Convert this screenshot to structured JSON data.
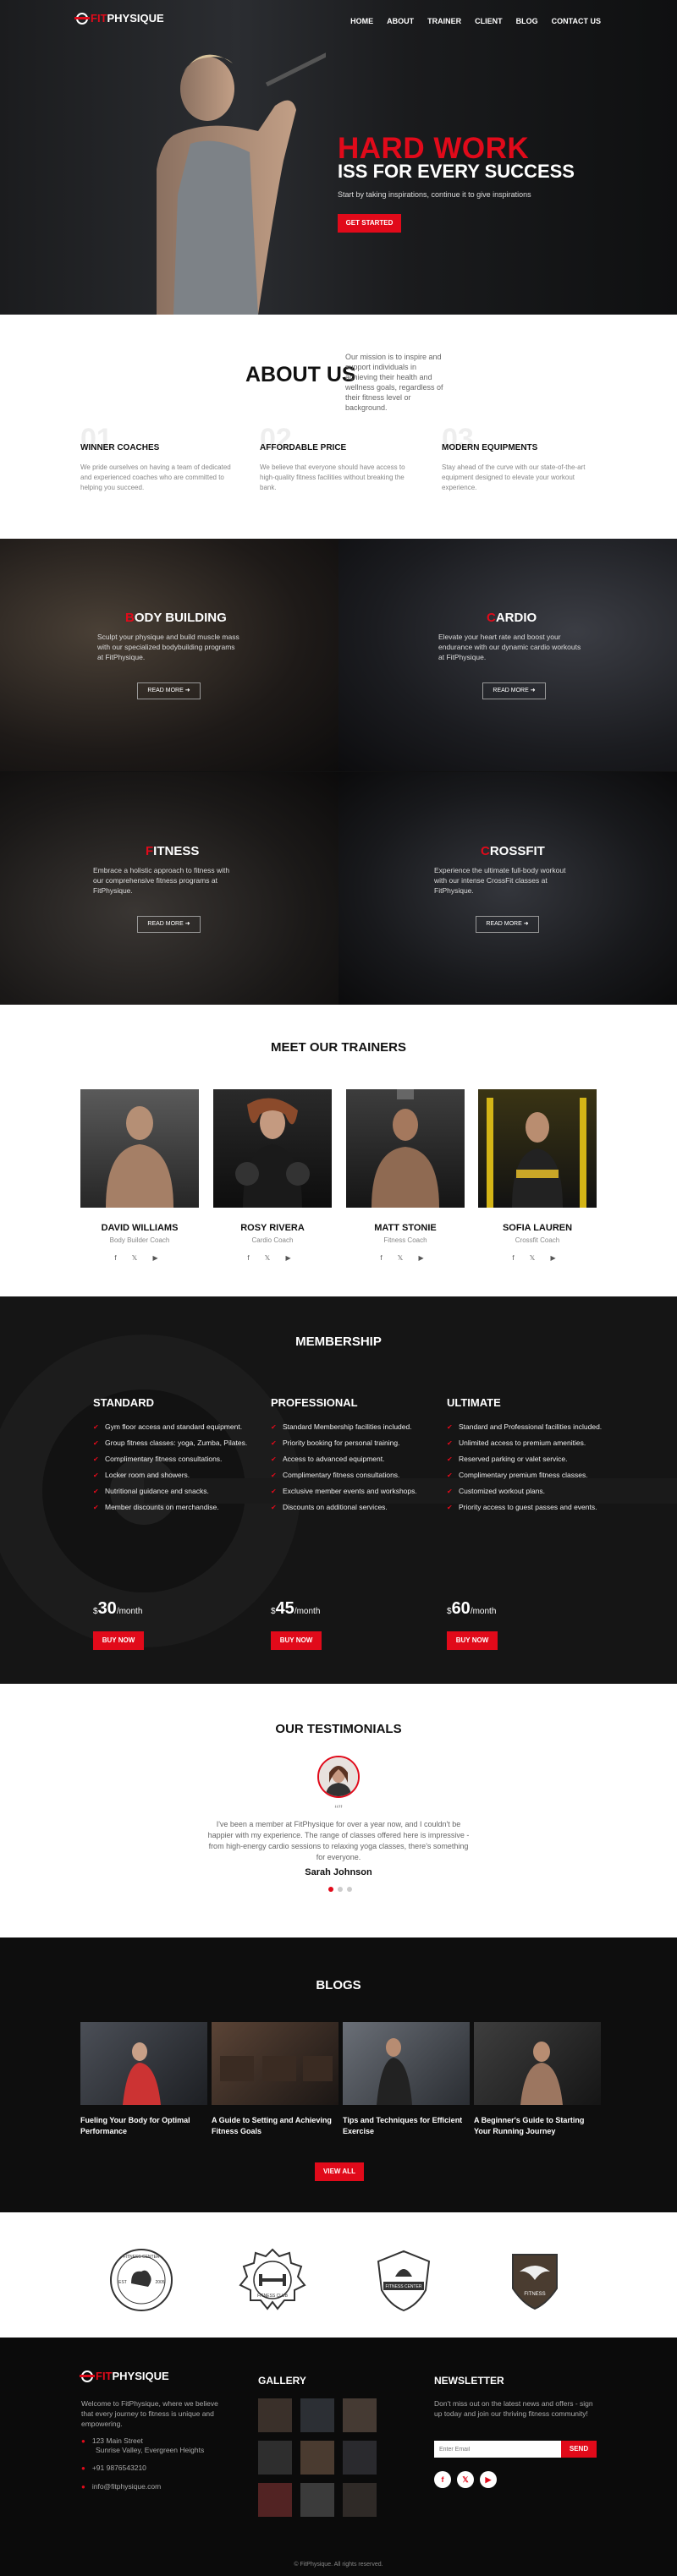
{
  "brand": {
    "prefix": "FIT",
    "name": "PHYSIQUE"
  },
  "nav": {
    "items": [
      "HOME",
      "ABOUT",
      "TRAINER",
      "CLIENT",
      "BLOG",
      "CONTACT US"
    ]
  },
  "hero": {
    "title_red": "HARD WORK",
    "title_white": "ISS FOR EVERY SUCCESS",
    "subtitle": "Start by taking inspirations, continue it to give inspirations",
    "cta": "GET STARTED"
  },
  "about": {
    "title": "ABOUT US",
    "text": "Our mission is to inspire and support individuals in achieving their health and wellness goals, regardless of their fitness level or background.",
    "features": [
      {
        "num": "01",
        "title": "WINNER COACHES",
        "desc": "We pride ourselves on having a team of dedicated and experienced coaches who are committed to helping you succeed."
      },
      {
        "num": "02",
        "title": "AFFORDABLE PRICE",
        "desc": "We believe that everyone should have access to high-quality fitness facilities without breaking the bank."
      },
      {
        "num": "03",
        "title": "MODERN EQUIPMENTS",
        "desc": "Stay ahead of the curve with our state-of-the-art equipment designed to elevate your workout experience."
      }
    ]
  },
  "programs": {
    "read_more": "READ MORE",
    "items": [
      {
        "first": "B",
        "rest": "ODY BUILDING",
        "desc": "Sculpt your physique and build muscle mass with our specialized bodybuilding programs at FitPhysique."
      },
      {
        "first": "C",
        "rest": "ARDIO",
        "desc": "Elevate your heart rate and boost your endurance with our dynamic cardio workouts at FitPhysique."
      },
      {
        "first": "F",
        "rest": "ITNESS",
        "desc": "Embrace a holistic approach to fitness with our comprehensive fitness programs at FitPhysique."
      },
      {
        "first": "C",
        "rest": "ROSSFIT",
        "desc": "Experience the ultimate full-body workout with our intense CrossFit classes at FitPhysique."
      }
    ]
  },
  "trainers": {
    "title": "MEET OUR TRAINERS",
    "social": "f 𝕏 ▶",
    "items": [
      {
        "name": "DAVID WILLIAMS",
        "role": "Body Builder Coach"
      },
      {
        "name": "ROSY RIVERA",
        "role": "Cardio Coach"
      },
      {
        "name": "MATT STONIE",
        "role": "Fitness Coach"
      },
      {
        "name": "SOFIA LAUREN",
        "role": "Crossfit Coach"
      }
    ]
  },
  "membership": {
    "title": "MEMBERSHIP",
    "button": "BUY NOW",
    "per": "/month",
    "plans": [
      {
        "name": "STANDARD",
        "price": "30",
        "features": [
          "Gym floor access and standard equipment.",
          "Group fitness classes: yoga, Zumba, Pilates.",
          "Complimentary fitness consultations.",
          "Locker room and showers.",
          "Nutritional guidance and snacks.",
          "Member discounts on merchandise."
        ]
      },
      {
        "name": "PROFESSIONAL",
        "price": "45",
        "features": [
          "Standard Membership facilities included.",
          "Priority booking for personal training.",
          "Access to advanced equipment.",
          "Complimentary fitness consultations.",
          "Exclusive member events and workshops.",
          "Discounts on additional services."
        ]
      },
      {
        "name": "ULTIMATE",
        "price": "60",
        "features": [
          "Standard and Professional facilities included.",
          "Unlimited access to premium amenities.",
          "Reserved parking or valet service.",
          "Complimentary premium fitness classes.",
          "Customized workout plans.",
          "Priority access to guest passes and events."
        ]
      }
    ]
  },
  "testimonials": {
    "title": "OUR TESTIMONIALS",
    "quote_mark": "“”",
    "text": "I've been a member at FitPhysique for over a year now, and I couldn't be happier with my experience. The range of classes offered here is impressive - from high-energy cardio sessions to relaxing yoga classes, there's something for everyone.",
    "name": "Sarah Johnson"
  },
  "blogs": {
    "title": "BLOGS",
    "button": "VIEW ALL",
    "items": [
      {
        "title": "Fueling Your Body for Optimal Performance"
      },
      {
        "title": "A Guide to Setting and Achieving Fitness Goals"
      },
      {
        "title": "Tips and Techniques for Efficient Exercise"
      },
      {
        "title": "A Beginner's Guide to Starting Your Running Journey"
      }
    ]
  },
  "badges": {
    "b1_top": "FITNESS CENTER",
    "b1_mid": "EST",
    "b1_year": "2005",
    "b2_text": "FITNESS CLUB",
    "b3_text": "FITNESS CENTER",
    "b4_text": "FITNESS"
  },
  "footer": {
    "about": "Welcome to FitPhysique, where we believe that every journey to fitness is unique and empowering.",
    "address1": "123 Main Street",
    "address2": "Sunrise Valley, Evergreen Heights",
    "phone": "+91 9876543210",
    "email": "info@fitphysique.com",
    "gallery_title": "GALLERY",
    "newsletter_title": "NEWSLETTER",
    "newsletter_text": "Don't miss out on the latest news and offers - sign up today and join our thriving fitness community!",
    "email_placeholder": "Enter Email",
    "send": "SEND",
    "socials": [
      "f",
      "𝕏",
      "▶"
    ],
    "copyright": "© FitPhysique. All rights reserved."
  }
}
